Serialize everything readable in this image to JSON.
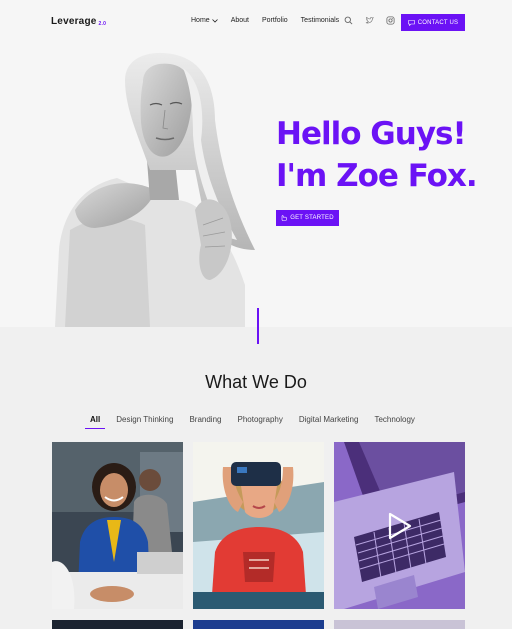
{
  "brand": {
    "name": "Leverage",
    "version": "2.0",
    "accent": "#6b12f5"
  },
  "nav": {
    "links": [
      {
        "label": "Home",
        "has_dropdown": true
      },
      {
        "label": "About"
      },
      {
        "label": "Portfolio"
      },
      {
        "label": "Testimonials"
      }
    ],
    "icons": [
      "search-icon",
      "twitter-icon",
      "instagram-icon"
    ],
    "contact_label": "CONTACT US"
  },
  "hero": {
    "line1": "Hello Guys!",
    "line2": "I'm Zoe Fox.",
    "cta_label": "GET STARTED"
  },
  "services": {
    "title": "What We Do",
    "filters": [
      "All",
      "Design Thinking",
      "Branding",
      "Photography",
      "Digital Marketing",
      "Technology"
    ],
    "active_filter": "All",
    "cards": [
      "team-meeting-photo",
      "vr-headset-photo",
      "laptop-video-photo"
    ]
  }
}
